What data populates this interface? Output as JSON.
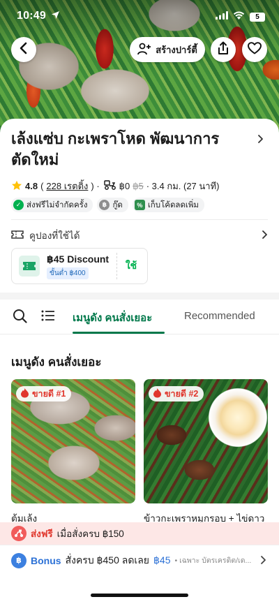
{
  "status_bar": {
    "time": "10:49",
    "battery": "5"
  },
  "header": {
    "create_party_label": "สร้างปาร์ตี้"
  },
  "restaurant": {
    "name": "เล้งแซ่บ กะเพราโหด พัฒนาการ ตัดใหม่",
    "rating": "4.8",
    "reviews": "228 เรตติ้ง",
    "delivery_fee": "฿0",
    "delivery_fee_original": "฿5",
    "distance": "· 3.4 กม. (27 นาที)",
    "badges": [
      {
        "label": "ส่งฟรีไม่จำกัดครั้ง",
        "icon": "free-delivery-icon",
        "color": "#00b14f"
      },
      {
        "label": "กู๊ด",
        "icon": "value-icon",
        "color": "#8e8e8e"
      },
      {
        "label": "เก็บโค้ดลดเพิ่ม",
        "icon": "coupon-code-icon",
        "color": "#2f8f4e"
      }
    ]
  },
  "coupons": {
    "section_label": "คูปองที่ใช้ได้",
    "items": [
      {
        "title": "฿45 Discount",
        "min_spend": "ขั้นต่ำ ฿400",
        "action": "ใช้"
      }
    ]
  },
  "tabs": {
    "active": "เมนูดัง คนสั่งเยอะ",
    "other": "Recommended"
  },
  "menu_section": {
    "title": "เมนูดัง คนสั่งเยอะ",
    "items": [
      {
        "badge": "ขายดี #1",
        "name": "ต้มเล้ง"
      },
      {
        "badge": "ขายดี #2",
        "name": "ข้าวกะเพราหมูกรอบ + ไข่ดาว"
      }
    ]
  },
  "promos": {
    "free_delivery": {
      "highlight": "ส่งฟรี",
      "text": "เมื่อสั่งครบ ฿150"
    },
    "bonus": {
      "highlight": "Bonus",
      "text": "สั่งครบ ฿450 ลดเลย",
      "amount": "฿45",
      "note": "• เฉพาะ บัตรเครดิต/เด..."
    }
  },
  "colors": {
    "brand_green": "#00784a",
    "accent_green": "#00b14f",
    "promo_red": "#e0362c",
    "bonus_blue": "#2c71d6"
  }
}
